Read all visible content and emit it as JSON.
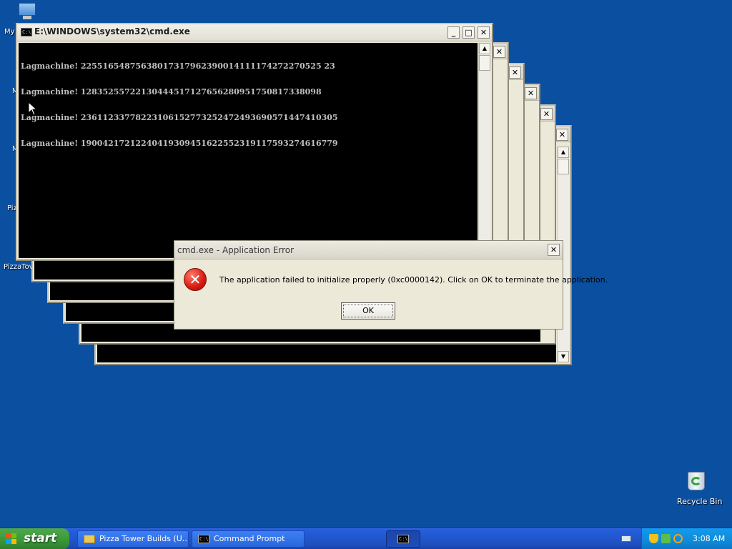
{
  "desktop": {
    "icons": [
      {
        "name": "My Computer",
        "visible_label": "My"
      },
      {
        "name": "Recycle Bin",
        "visible_label": "Recycle Bin"
      }
    ],
    "partial_labels": [
      "M",
      "M",
      "Pizz",
      "PizzaTov"
    ]
  },
  "main_window": {
    "title": "E:\\WINDOWS\\system32\\cmd.exe",
    "icon_glyph": "C:\\",
    "buttons": {
      "minimize": "_",
      "maximize": "□",
      "close": "✕"
    },
    "console_lines": [
      "Lagmachine! 22551654875638017317962390014111174272270525 23",
      "Lagmachine! 12835255722130444517127656280951750817338098",
      "Lagmachine! 23611233778223106152773252472493690571447410305",
      "Lagmachine! 19004217212240419309451622552319117593274616779"
    ]
  },
  "stacked_windows": [
    {
      "title": ""
    },
    {
      "title": ""
    },
    {
      "title": ""
    },
    {
      "title": ""
    },
    {
      "title": ""
    }
  ],
  "dialog": {
    "title": "cmd.exe - Application Error",
    "message": "The application failed to initialize properly (0xc0000142). Click on OK to terminate the application.",
    "ok_label": "OK",
    "icon": "error-icon",
    "icon_glyph": "✕"
  },
  "taskbar": {
    "start_label": "start",
    "tasks": [
      {
        "label": "Pizza Tower Builds (U...",
        "icon": "folder-icon"
      },
      {
        "label": "Command Prompt",
        "icon": "cmd-icon"
      },
      {
        "label": "",
        "icon": "cmd-icon"
      }
    ],
    "clock": "3:08 AM"
  }
}
